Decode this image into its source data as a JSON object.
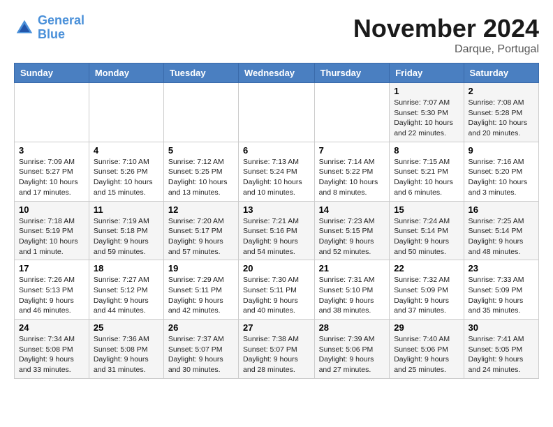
{
  "header": {
    "logo_line1": "General",
    "logo_line2": "Blue",
    "month": "November 2024",
    "location": "Darque, Portugal"
  },
  "weekdays": [
    "Sunday",
    "Monday",
    "Tuesday",
    "Wednesday",
    "Thursday",
    "Friday",
    "Saturday"
  ],
  "weeks": [
    [
      {
        "day": "",
        "info": ""
      },
      {
        "day": "",
        "info": ""
      },
      {
        "day": "",
        "info": ""
      },
      {
        "day": "",
        "info": ""
      },
      {
        "day": "",
        "info": ""
      },
      {
        "day": "1",
        "info": "Sunrise: 7:07 AM\nSunset: 5:30 PM\nDaylight: 10 hours and 22 minutes."
      },
      {
        "day": "2",
        "info": "Sunrise: 7:08 AM\nSunset: 5:28 PM\nDaylight: 10 hours and 20 minutes."
      }
    ],
    [
      {
        "day": "3",
        "info": "Sunrise: 7:09 AM\nSunset: 5:27 PM\nDaylight: 10 hours and 17 minutes."
      },
      {
        "day": "4",
        "info": "Sunrise: 7:10 AM\nSunset: 5:26 PM\nDaylight: 10 hours and 15 minutes."
      },
      {
        "day": "5",
        "info": "Sunrise: 7:12 AM\nSunset: 5:25 PM\nDaylight: 10 hours and 13 minutes."
      },
      {
        "day": "6",
        "info": "Sunrise: 7:13 AM\nSunset: 5:24 PM\nDaylight: 10 hours and 10 minutes."
      },
      {
        "day": "7",
        "info": "Sunrise: 7:14 AM\nSunset: 5:22 PM\nDaylight: 10 hours and 8 minutes."
      },
      {
        "day": "8",
        "info": "Sunrise: 7:15 AM\nSunset: 5:21 PM\nDaylight: 10 hours and 6 minutes."
      },
      {
        "day": "9",
        "info": "Sunrise: 7:16 AM\nSunset: 5:20 PM\nDaylight: 10 hours and 3 minutes."
      }
    ],
    [
      {
        "day": "10",
        "info": "Sunrise: 7:18 AM\nSunset: 5:19 PM\nDaylight: 10 hours and 1 minute."
      },
      {
        "day": "11",
        "info": "Sunrise: 7:19 AM\nSunset: 5:18 PM\nDaylight: 9 hours and 59 minutes."
      },
      {
        "day": "12",
        "info": "Sunrise: 7:20 AM\nSunset: 5:17 PM\nDaylight: 9 hours and 57 minutes."
      },
      {
        "day": "13",
        "info": "Sunrise: 7:21 AM\nSunset: 5:16 PM\nDaylight: 9 hours and 54 minutes."
      },
      {
        "day": "14",
        "info": "Sunrise: 7:23 AM\nSunset: 5:15 PM\nDaylight: 9 hours and 52 minutes."
      },
      {
        "day": "15",
        "info": "Sunrise: 7:24 AM\nSunset: 5:14 PM\nDaylight: 9 hours and 50 minutes."
      },
      {
        "day": "16",
        "info": "Sunrise: 7:25 AM\nSunset: 5:14 PM\nDaylight: 9 hours and 48 minutes."
      }
    ],
    [
      {
        "day": "17",
        "info": "Sunrise: 7:26 AM\nSunset: 5:13 PM\nDaylight: 9 hours and 46 minutes."
      },
      {
        "day": "18",
        "info": "Sunrise: 7:27 AM\nSunset: 5:12 PM\nDaylight: 9 hours and 44 minutes."
      },
      {
        "day": "19",
        "info": "Sunrise: 7:29 AM\nSunset: 5:11 PM\nDaylight: 9 hours and 42 minutes."
      },
      {
        "day": "20",
        "info": "Sunrise: 7:30 AM\nSunset: 5:11 PM\nDaylight: 9 hours and 40 minutes."
      },
      {
        "day": "21",
        "info": "Sunrise: 7:31 AM\nSunset: 5:10 PM\nDaylight: 9 hours and 38 minutes."
      },
      {
        "day": "22",
        "info": "Sunrise: 7:32 AM\nSunset: 5:09 PM\nDaylight: 9 hours and 37 minutes."
      },
      {
        "day": "23",
        "info": "Sunrise: 7:33 AM\nSunset: 5:09 PM\nDaylight: 9 hours and 35 minutes."
      }
    ],
    [
      {
        "day": "24",
        "info": "Sunrise: 7:34 AM\nSunset: 5:08 PM\nDaylight: 9 hours and 33 minutes."
      },
      {
        "day": "25",
        "info": "Sunrise: 7:36 AM\nSunset: 5:08 PM\nDaylight: 9 hours and 31 minutes."
      },
      {
        "day": "26",
        "info": "Sunrise: 7:37 AM\nSunset: 5:07 PM\nDaylight: 9 hours and 30 minutes."
      },
      {
        "day": "27",
        "info": "Sunrise: 7:38 AM\nSunset: 5:07 PM\nDaylight: 9 hours and 28 minutes."
      },
      {
        "day": "28",
        "info": "Sunrise: 7:39 AM\nSunset: 5:06 PM\nDaylight: 9 hours and 27 minutes."
      },
      {
        "day": "29",
        "info": "Sunrise: 7:40 AM\nSunset: 5:06 PM\nDaylight: 9 hours and 25 minutes."
      },
      {
        "day": "30",
        "info": "Sunrise: 7:41 AM\nSunset: 5:05 PM\nDaylight: 9 hours and 24 minutes."
      }
    ]
  ]
}
